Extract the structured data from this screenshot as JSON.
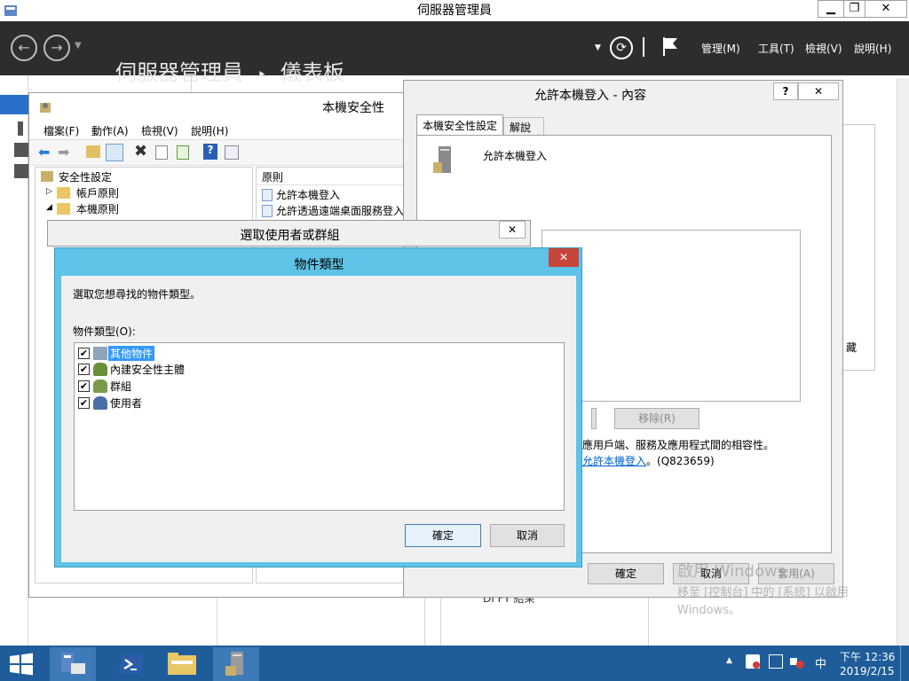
{
  "main_window": {
    "title": "伺服器管理員",
    "minimize": "▁",
    "maximize": "❐",
    "close": "✕"
  },
  "header": {
    "breadcrumb_root": "伺服器管理員",
    "breadcrumb_sep": "‣",
    "breadcrumb_page": "儀表板",
    "menus": [
      "管理(M)",
      "工具(T)",
      "檢視(V)",
      "說明(H)"
    ]
  },
  "secpol": {
    "title": "本機安全性",
    "menus": [
      "檔案(F)",
      "動作(A)",
      "檢視(V)",
      "說明(H)"
    ],
    "tree": [
      "安全性設定",
      "帳戶原則",
      "本機原則"
    ],
    "list_header": "原則",
    "list_items": [
      "允許本機登入",
      "允許透過遠端桌面服務登入"
    ]
  },
  "props": {
    "title": "允許本機登入 - 內容",
    "help": "?",
    "close": "✕",
    "tabs": [
      "本機安全性設定",
      "解說"
    ],
    "policy_name": "允許本機登入",
    "remove_button": "移除(R)",
    "info_text": "應用戶端、服務及應用程式間的相容性。",
    "link_text": "允許本機登入",
    "link_suffix": "。(Q823659)",
    "ok": "確定",
    "cancel": "取消",
    "apply": "套用(A)",
    "hidden_fragment": "藏"
  },
  "select_dialog": {
    "title": "選取使用者或群組",
    "close": "✕",
    "partial": "DI FY 結果"
  },
  "object_types": {
    "title": "物件類型",
    "close": "✕",
    "instruction": "選取您想尋找的物件類型。",
    "list_label": "物件類型(O):",
    "items": [
      {
        "label": "其他物件",
        "checked": true,
        "icon": "object-icon"
      },
      {
        "label": "內建安全性主體",
        "checked": true,
        "icon": "principal-icon"
      },
      {
        "label": "群組",
        "checked": true,
        "icon": "group-icon"
      },
      {
        "label": "使用者",
        "checked": true,
        "icon": "user-icon"
      }
    ],
    "check_glyph": "✔",
    "ok": "確定",
    "cancel": "取消"
  },
  "watermark": {
    "line1": "啟用 Windows",
    "line2": "移至 [控制台] 中的 [系統] 以啟用",
    "line3": "Windows。"
  },
  "taskbar": {
    "time": "下午 12:36",
    "date": "2019/2/15",
    "ime": "中",
    "tray_arrow": "▲"
  },
  "colors": {
    "header_bg": "#2d2d30",
    "dialog_frame": "#5ec3e6",
    "close_red": "#c7463b",
    "taskbar": "#1e5d99",
    "selection": "#3399ff",
    "link": "#0066cc"
  }
}
